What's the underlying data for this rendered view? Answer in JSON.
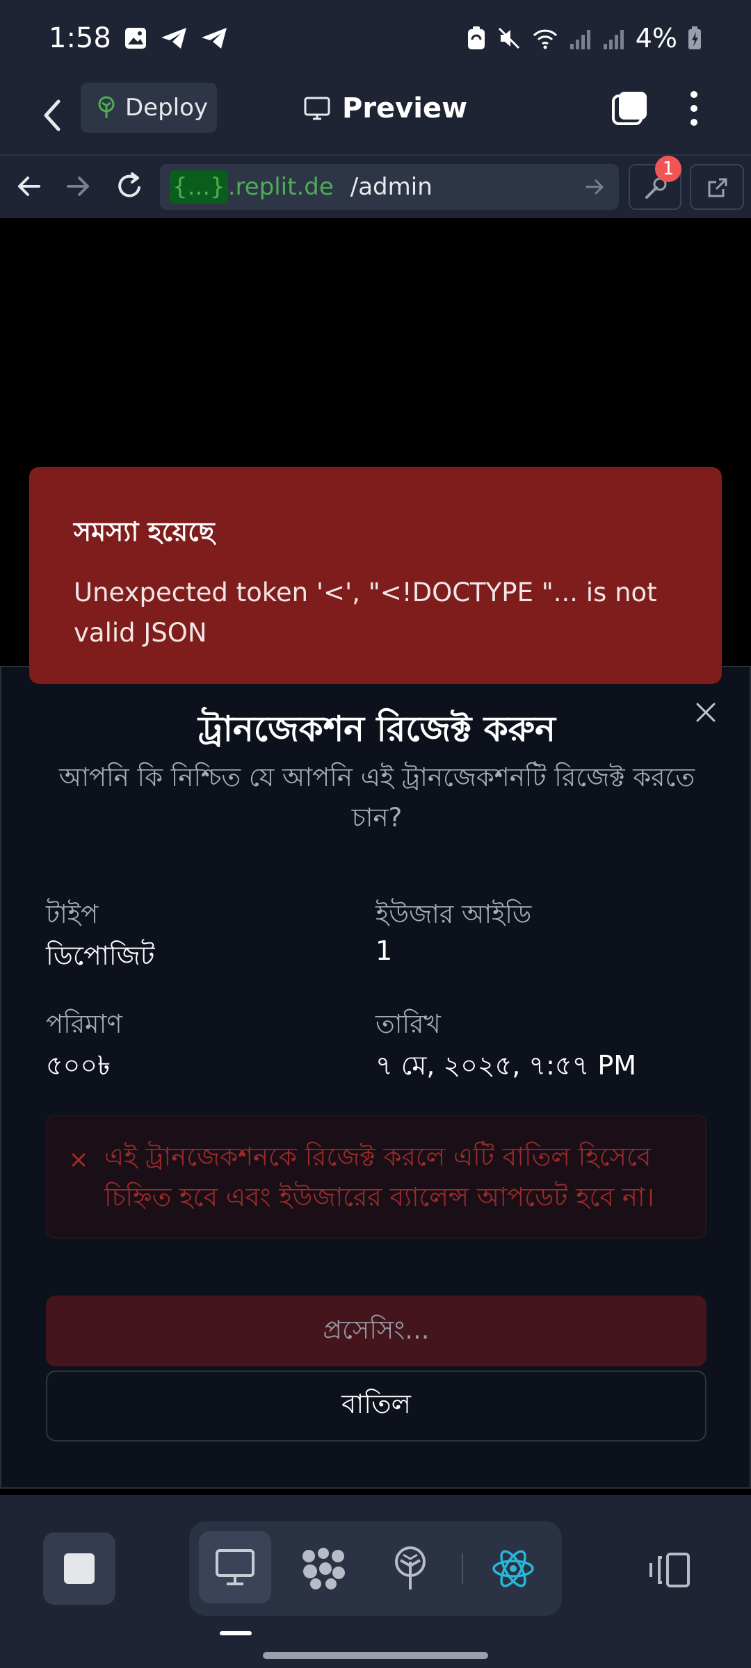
{
  "status_bar": {
    "time": "1:58",
    "battery": "4%"
  },
  "header": {
    "deploy_label": "Deploy",
    "preview_label": "Preview"
  },
  "browser": {
    "url_chip": "{...}",
    "url_domain": ".replit.de",
    "url_path": "/admin",
    "devtools_badge": "1"
  },
  "toast": {
    "title": "সমস্যা হয়েছে",
    "message": "Unexpected token '<', \"<!DOCTYPE \"... is not valid JSON"
  },
  "dialog": {
    "title": "ট্রানজেকশন রিজেক্ট করুন",
    "description": "আপনি কি নিশ্চিত যে আপনি এই ট্রানজেকশনটি রিজেক্ট করতে চান?",
    "fields": {
      "type_label": "টাইপ",
      "type_value": "ডিপোজিট",
      "user_id_label": "ইউজার আইডি",
      "user_id_value": "1",
      "amount_label": "পরিমাণ",
      "amount_value": "৫০০৳",
      "date_label": "তারিখ",
      "date_value": "৭ মে, ২০২৫, ৭:৫৭ PM"
    },
    "warning": "এই ট্রানজেকশনকে রিজেক্ট করলে এটি বাতিল হিসেবে চিহ্নিত হবে এবং ইউজারের ব্যালেন্স আপডেট হবে না।",
    "processing_label": "প্রসেসিং...",
    "cancel_label": "বাতিল"
  },
  "colors": {
    "toast_bg": "#7f1d1d",
    "dialog_bg": "#0c111c",
    "warning_text": "#9c2a2a",
    "url_green": "#4caf50",
    "badge_red": "#f25555",
    "react_blue": "#29b6d8"
  },
  "icons": [
    "gallery-icon",
    "telegram-icon",
    "battery-saver-icon",
    "mute-icon",
    "wifi-icon",
    "signal-icon",
    "battery-icon",
    "back-chevron-icon",
    "deploy-icon",
    "monitor-icon",
    "tabs-icon",
    "kebab-menu-icon",
    "arrow-left-icon",
    "arrow-right-icon",
    "reload-icon",
    "url-go-icon",
    "devtools-wrench-icon",
    "external-link-icon",
    "close-icon",
    "error-x-icon",
    "stop-icon",
    "preview-monitor-icon",
    "agent-icon",
    "deploy-tree-icon",
    "react-icon",
    "panel-icon"
  ]
}
